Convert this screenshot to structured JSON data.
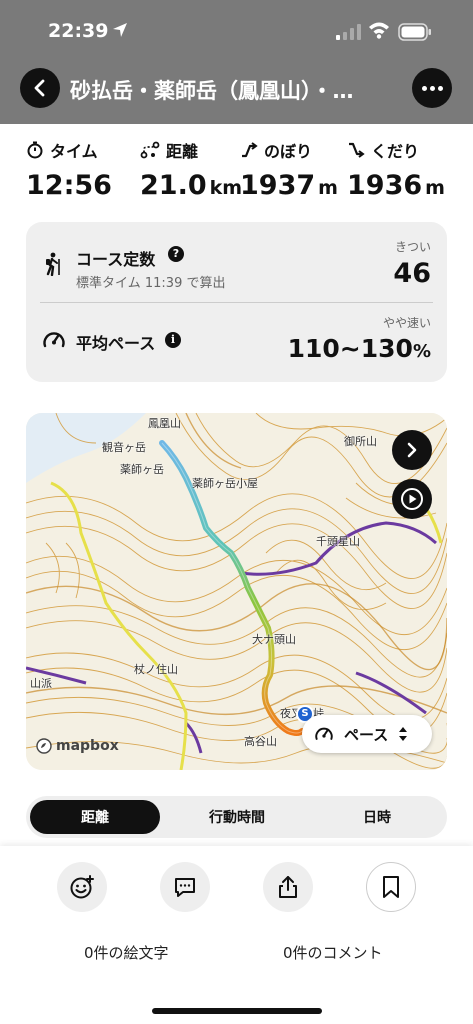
{
  "status_bar": {
    "time": "22:39"
  },
  "header": {
    "title": "砂払岳・薬師岳（鳳凰山）・…"
  },
  "stats": [
    {
      "label": "タイム",
      "value": "12:56",
      "unit": "",
      "icon": "stopwatch-icon"
    },
    {
      "label": "距離",
      "value": "21.0",
      "unit": "km",
      "icon": "route-icon"
    },
    {
      "label": "のぼり",
      "value": "1937",
      "unit": "m",
      "icon": "ascent-icon"
    },
    {
      "label": "くだり",
      "value": "1936",
      "unit": "m",
      "icon": "descent-icon"
    }
  ],
  "course_card": {
    "constant_label": "コース定数",
    "constant_sub": "標準タイム 11:39 で算出",
    "constant_tag": "きつい",
    "constant_value": "46",
    "pace_label": "平均ペース",
    "pace_tag": "やや速い",
    "pace_value": "110~130",
    "pace_unit": "%"
  },
  "map": {
    "labels": [
      "鳳凰山",
      "観音ヶ岳",
      "薬師ヶ岳",
      "薬師ヶ岳小屋",
      "御所山",
      "千頭星山",
      "大ナ頭山",
      "夜叉神峠",
      "高谷山",
      "杖ノ住山",
      "山派"
    ],
    "attribution": "mapbox",
    "pace_selector": "ペース",
    "colors": {
      "route_start": "#6fb8e6",
      "route_mid": "#8cc63f",
      "route_end": "#f07a1a",
      "contour": "#d39a3a",
      "trail": "#e6e04a",
      "boundary": "#6b3aa0"
    }
  },
  "tabs": [
    {
      "label": "距離",
      "active": true
    },
    {
      "label": "行動時間",
      "active": false
    },
    {
      "label": "日時",
      "active": false
    }
  ],
  "bottom": {
    "emoji_count": "0件の絵文字",
    "comment_count": "0件のコメント"
  }
}
